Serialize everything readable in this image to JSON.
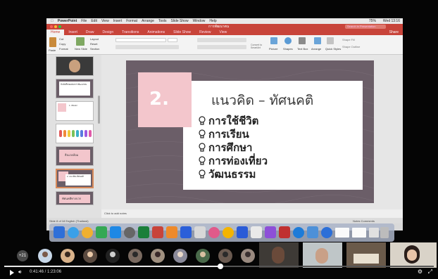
{
  "menubar": {
    "app": "PowerPoint",
    "items": [
      "File",
      "Edit",
      "View",
      "Insert",
      "Format",
      "Arrange",
      "Tools",
      "Slide Show",
      "Window",
      "Help"
    ],
    "status": "75%",
    "clock": "Wed 13:16"
  },
  "window": {
    "doc_title": "การพัฒนาตน",
    "search_placeholder": "Search in Presentation",
    "share": "Share"
  },
  "ribbon_tabs": [
    "Home",
    "Insert",
    "Draw",
    "Design",
    "Transitions",
    "Animations",
    "Slide Show",
    "Review",
    "View"
  ],
  "ribbon_labels": {
    "paste": "Paste",
    "cut": "Cut",
    "copy": "Copy",
    "format": "Format",
    "new_slide": "New Slide",
    "layout": "Layout",
    "reset": "Reset",
    "section": "Section",
    "picture": "Picture",
    "shapes": "Shapes",
    "text_box": "Text Box",
    "arrange": "Arrange",
    "quick_styles": "Quick Styles",
    "shape_fill": "Shape Fill",
    "shape_outline": "Shape Outline",
    "convert": "Convert to SmartArt"
  },
  "thumbnails": [
    {
      "num": "",
      "label": ""
    },
    {
      "num": "",
      "label": "ปัจจัยที่ส่งผลต่อการพัฒนาตน"
    },
    {
      "num": "",
      "label": "1. ตนเอง"
    },
    {
      "num": "",
      "label": ""
    },
    {
      "num": "",
      "label": "สิ่งแวดล้อม"
    },
    {
      "num": "",
      "label": "2. แนวคิด-ทัศนคติ"
    },
    {
      "num": "",
      "label": "ทัศนคติทางบวก"
    }
  ],
  "slide": {
    "number": "2.",
    "title": "แนวคิด – ทัศนคติ",
    "bullets": [
      "การใช้ชีวิต",
      "การเรียน",
      "การศึกษา",
      "การท่องเที่ยว",
      "วัฒนธรรม"
    ]
  },
  "notes_placeholder": "Click to add notes",
  "status_bar": {
    "left": "Slide 8 of 18    English (Thailand)",
    "right": "Notes    Comments"
  },
  "participants": {
    "extra_count": "+21"
  },
  "player": {
    "time": "0:41:46 / 1:23:06",
    "progress": 0.503
  },
  "colors": {
    "ppt_red": "#c8443a",
    "slide_bg": "#6b5e68",
    "slide_pink": "#f3c6cc"
  }
}
